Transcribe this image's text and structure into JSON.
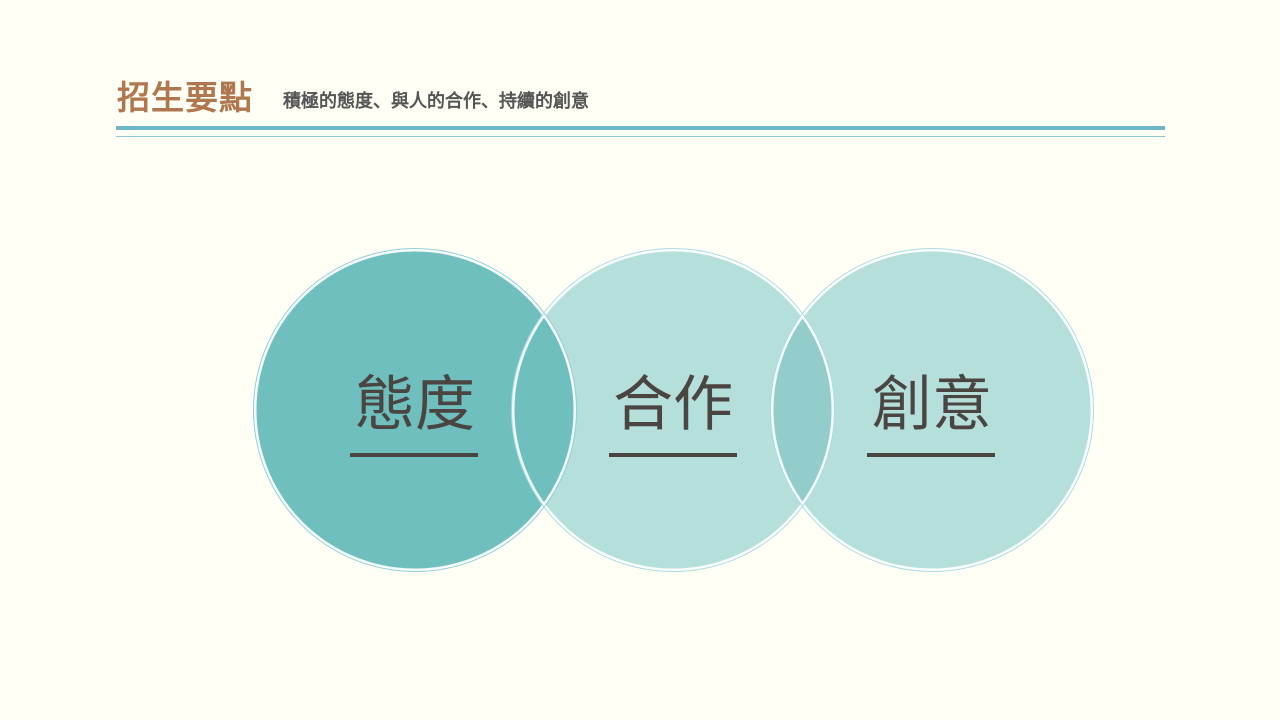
{
  "header": {
    "title": "招生要點",
    "subtitle": "積極的態度、與人的合作、持續的創意"
  },
  "diagram": {
    "circles": [
      {
        "label": "態度",
        "fill": "#6fbfbf"
      },
      {
        "label": "合作",
        "fill": "#b5dfdb"
      },
      {
        "label": "創意",
        "fill": "#b5dfdb"
      }
    ],
    "overlap_fill": "#6fbfbf",
    "overlap_fill_secondary": "#92cccb",
    "outline_color": "#ffffff",
    "text_color": "#4a4540"
  },
  "colors": {
    "background": "#fffff5",
    "title": "#b0764e",
    "rule": "#6bb8c4"
  }
}
